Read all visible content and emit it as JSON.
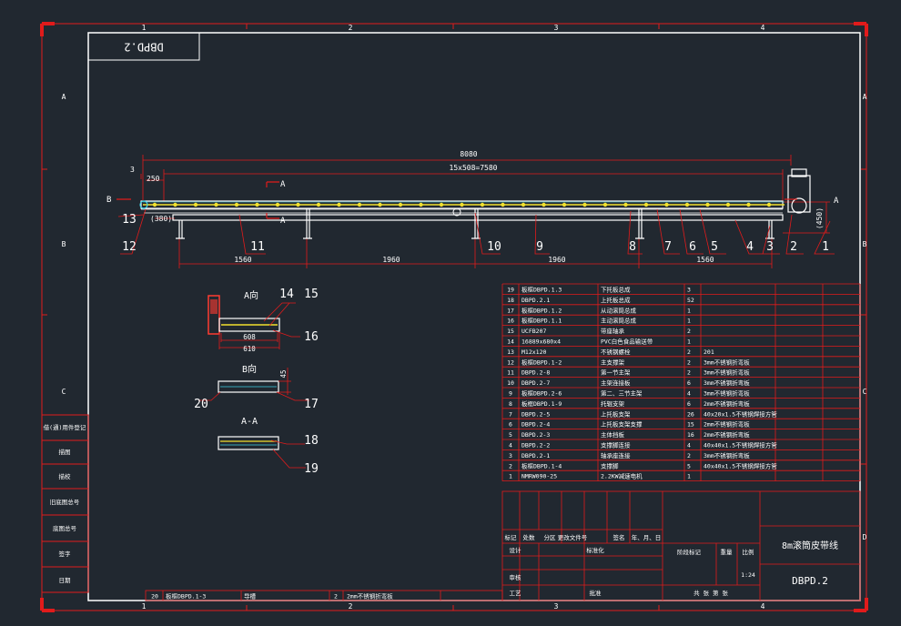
{
  "colors": {
    "background": "#212830",
    "frame": "#e11b1b",
    "border": "#ffffff",
    "table_line": "#e11b1b",
    "dimension": "#e11b1b",
    "conveyor": "#ffffff",
    "belt_accent": "#f2e12e",
    "belt_edge": "#3fd3e6",
    "motor": "#ff3b30"
  },
  "zones": {
    "top": [
      "1",
      "2",
      "3",
      "4"
    ],
    "bottom": [
      "1",
      "2",
      "3",
      "4"
    ],
    "left": [
      "A",
      "B",
      "C"
    ],
    "right": [
      "A",
      "B",
      "C",
      "D"
    ]
  },
  "drawing_code_box": "DBPD.2",
  "main_view": {
    "overall_length": "8080",
    "pitch": "15x508=7580",
    "dim_3": "3",
    "dim_250": "250",
    "dim_380": "(380)",
    "dim_450": "(450)",
    "spans": [
      "1560",
      "1960",
      "1960",
      "1560"
    ],
    "section_markers": {
      "a": "A",
      "b": "B"
    },
    "balloons": [
      "1",
      "2",
      "3",
      "4",
      "5",
      "6",
      "7",
      "8",
      "9",
      "10",
      "11",
      "12",
      "13"
    ]
  },
  "views": {
    "a": {
      "title": "A向",
      "dims": [
        "608",
        "610"
      ],
      "balloons": [
        "14",
        "15",
        "16"
      ]
    },
    "b": {
      "title": "B向",
      "dim": "45",
      "balloons": [
        "20",
        "17"
      ]
    },
    "aa": {
      "title": "A-A",
      "balloons": [
        "18",
        "19"
      ]
    }
  },
  "bom": [
    {
      "no": "19",
      "code": "板框DBPD.1.3",
      "name": "下托板总成",
      "qty": "3",
      "note": ""
    },
    {
      "no": "18",
      "code": "DBPD.2.1",
      "name": "上托板总成",
      "qty": "52",
      "note": ""
    },
    {
      "no": "17",
      "code": "板框DBPD.1.2",
      "name": "从动滚筒总成",
      "qty": "1",
      "note": ""
    },
    {
      "no": "16",
      "code": "板框DBPD.1.1",
      "name": "主动滚筒总成",
      "qty": "1",
      "note": ""
    },
    {
      "no": "15",
      "code": "UCFB207",
      "name": "带座轴承",
      "qty": "2",
      "note": ""
    },
    {
      "no": "14",
      "code": "16889x680x4",
      "name": "PVC白色食品输送带",
      "qty": "1",
      "note": ""
    },
    {
      "no": "13",
      "code": "M12x120",
      "name": "不锈钢螺栓",
      "qty": "2",
      "note": "201"
    },
    {
      "no": "12",
      "code": "板框DBPD.1-2",
      "name": "主支撑架",
      "qty": "2",
      "note": "3mm不锈钢折弯板"
    },
    {
      "no": "11",
      "code": "DBPD.2-8",
      "name": "第一节主架",
      "qty": "2",
      "note": "3mm不锈钢折弯板"
    },
    {
      "no": "10",
      "code": "DBPD.2-7",
      "name": "主架连接板",
      "qty": "6",
      "note": "3mm不锈钢折弯板"
    },
    {
      "no": "9",
      "code": "板框DBPD.2-6",
      "name": "第二、三节主架",
      "qty": "4",
      "note": "3mm不锈钢折弯板"
    },
    {
      "no": "8",
      "code": "板框DBPD.1-9",
      "name": "托辊支架",
      "qty": "6",
      "note": "2mm不锈钢折弯板"
    },
    {
      "no": "7",
      "code": "DBPD.2-5",
      "name": "上托板支架",
      "qty": "26",
      "note": "40x20x1.5不锈钢焊接方管"
    },
    {
      "no": "6",
      "code": "DBPD.2-4",
      "name": "上托板支架支撑",
      "qty": "15",
      "note": "2mm不锈钢折弯板"
    },
    {
      "no": "5",
      "code": "DBPD.2-3",
      "name": "主体挡板",
      "qty": "16",
      "note": "2mm不锈钢折弯板"
    },
    {
      "no": "4",
      "code": "DBPD.2-2",
      "name": "支撑脚连接",
      "qty": "4",
      "note": "40x40x1.5不锈钢焊接方管"
    },
    {
      "no": "3",
      "code": "DBPD.2-1",
      "name": "轴承座连接",
      "qty": "2",
      "note": "3mm不锈钢折弯板"
    },
    {
      "no": "2",
      "code": "板框DBPD.1-4",
      "name": "支撑脚",
      "qty": "5",
      "note": "40x40x1.5不锈钢焊接方管"
    },
    {
      "no": "1",
      "code": "NMRW090-25",
      "name": "2.2KW减速电机",
      "qty": "1",
      "note": ""
    }
  ],
  "extra_row": {
    "no": "20",
    "code": "板框DBPD.1-3",
    "name": "导槽",
    "qty": "2",
    "note": "2mm不锈钢折弯板"
  },
  "title_block": {
    "title": "8m滚筒皮带线",
    "code": "DBPD.2",
    "scale": "1:24",
    "rev_headers": [
      "标记",
      "处数",
      "分区",
      "更改文件号",
      "签名",
      "年、月、日"
    ],
    "labels": {
      "design": "设计",
      "standard": "标准化",
      "stage": "阶段标记",
      "weight": "重量",
      "ratio": "比例",
      "check": "审核",
      "process": "工艺",
      "approve": "批准",
      "sheets": "共  张  第  张"
    }
  },
  "left_strip": [
    "借(通)用件登记",
    "旧底图总号",
    "底图总号",
    "签字",
    "日期",
    "描图",
    "描校"
  ]
}
